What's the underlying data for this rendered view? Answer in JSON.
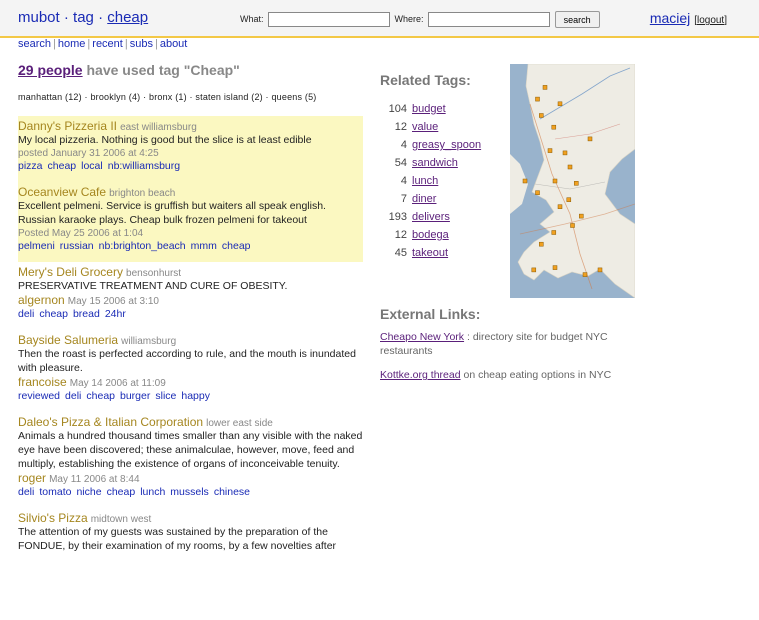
{
  "header": {
    "brand": [
      "mubot",
      "tag",
      "cheap"
    ],
    "brand_sep": "·",
    "search": {
      "what_label": "What:",
      "where_label": "Where:",
      "button": "search"
    },
    "user": "maciej",
    "logout": "logout"
  },
  "nav": [
    "search",
    "home",
    "recent",
    "subs",
    "about"
  ],
  "page_heading": {
    "count_link": "29 people",
    "rest": "have used tag \"Cheap\""
  },
  "boroughs": [
    "manhattan (12)",
    "brooklyn (4)",
    "bronx (1)",
    "staten island (2)",
    "queens (5)"
  ],
  "entries": [
    {
      "title": "Danny's Pizzeria II",
      "location": "east williamsburg",
      "text": "My local pizzeria. Nothing is good but the slice is at least edible",
      "user": "",
      "date": "posted January 31 2006 at 4:25",
      "tags": [
        "pizza",
        "cheap",
        "local",
        "nb:williamsburg"
      ],
      "highlight": true
    },
    {
      "title": "Oceanview Cafe",
      "location": "brighton beach",
      "text": "Excellent pelmeni. Service is gruffish but waiters all speak english. Russian karaoke plays. Cheap bulk frozen pelmeni for takeout",
      "user": "",
      "date": "Posted May 25 2006 at 1:04",
      "tags": [
        "pelmeni",
        "russian",
        "nb:brighton_beach",
        "mmm",
        "cheap"
      ],
      "highlight": true
    },
    {
      "title": "Mery's Deli Grocery",
      "location": "bensonhurst",
      "text": "PRESERVATIVE TREATMENT AND CURE OF OBESITY.",
      "user": "algernon",
      "date": "May 15 2006 at 3:10",
      "tags": [
        "deli",
        "cheap",
        "bread",
        "24hr"
      ],
      "highlight": false
    },
    {
      "title": "Bayside Salumeria",
      "location": "williamsburg",
      "text": "Then the roast is perfected according to rule, and the mouth is inundated with pleasure.",
      "user": "francoise",
      "date": "May 14 2006 at 11:09",
      "tags": [
        "reviewed",
        "deli",
        "cheap",
        "burger",
        "slice",
        "happy"
      ],
      "highlight": false
    },
    {
      "title": "Daleo's Pizza & Italian Corporation",
      "location": "lower east side",
      "text": "Animals a hundred thousand times smaller than any visible with the naked eye have been discovered; these animalculae, however, move, feed and multiply, establishing the existence of organs of inconceivable tenuity.",
      "user": "roger",
      "date": "May 11 2006 at 8:44",
      "tags": [
        "deli",
        "tomato",
        "niche",
        "cheap",
        "lunch",
        "mussels",
        "chinese"
      ],
      "highlight": false
    },
    {
      "title": "Silvio's Pizza",
      "location": "midtown west",
      "text": "The attention of my guests was sustained by the preparation of the FONDUE, by their examination of my rooms, by a few novelties after",
      "user": "",
      "date": "",
      "tags": [],
      "highlight": false
    }
  ],
  "related": {
    "title": "Related Tags:",
    "tags": [
      {
        "count": "104",
        "name": "budget"
      },
      {
        "count": "12",
        "name": "value"
      },
      {
        "count": "4",
        "name": "greasy_spoon"
      },
      {
        "count": "54",
        "name": "sandwich"
      },
      {
        "count": "4",
        "name": "lunch"
      },
      {
        "count": "7",
        "name": "diner"
      },
      {
        "count": "193",
        "name": "delivers"
      },
      {
        "count": "12",
        "name": "bodega"
      },
      {
        "count": "45",
        "name": "takeout"
      }
    ]
  },
  "external": {
    "title": "External Links:",
    "links": [
      {
        "link": "Cheapo New York",
        "desc": " : directory site for budget NYC restaurants"
      },
      {
        "link": "Kottke.org thread",
        "desc": " on cheap eating options in NYC"
      }
    ]
  },
  "colors": {
    "accent_bar": "#f3c846",
    "highlight": "#fbf8c1",
    "title_gold": "#a5861f",
    "link_blue": "#1a2bb5",
    "visited_purple": "#5a1f7a"
  },
  "map_markers": [
    [
      0.28,
      0.1
    ],
    [
      0.22,
      0.15
    ],
    [
      0.25,
      0.22
    ],
    [
      0.35,
      0.27
    ],
    [
      0.32,
      0.37
    ],
    [
      0.44,
      0.38
    ],
    [
      0.48,
      0.44
    ],
    [
      0.36,
      0.5
    ],
    [
      0.53,
      0.51
    ],
    [
      0.22,
      0.55
    ],
    [
      0.47,
      0.58
    ],
    [
      0.4,
      0.61
    ],
    [
      0.57,
      0.65
    ],
    [
      0.5,
      0.69
    ],
    [
      0.35,
      0.72
    ],
    [
      0.25,
      0.77
    ],
    [
      0.19,
      0.88
    ],
    [
      0.36,
      0.87
    ],
    [
      0.72,
      0.88
    ],
    [
      0.6,
      0.9
    ],
    [
      0.12,
      0.5
    ],
    [
      0.64,
      0.32
    ],
    [
      0.4,
      0.17
    ]
  ]
}
